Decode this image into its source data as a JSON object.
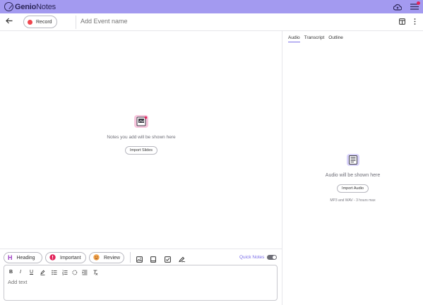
{
  "app": {
    "logo_bold": "Genio",
    "logo_light": "Notes"
  },
  "toolbar": {
    "record_label": "Record",
    "event_placeholder": "Add Event name"
  },
  "notes": {
    "empty_message": "Notes you add will be shown here",
    "import_slides_label": "Import Slides"
  },
  "right_panel": {
    "tabs": [
      {
        "label": "Audio",
        "active": true
      },
      {
        "label": "Transcript",
        "active": false
      },
      {
        "label": "Outline",
        "active": false
      }
    ],
    "empty_message": "Audio will be shown here",
    "import_audio_label": "Import Audio",
    "format_hint": "MP3 and WAV - 3 hours max"
  },
  "quickbar": {
    "chips": [
      {
        "label": "Heading",
        "icon": "heading-icon"
      },
      {
        "label": "Important",
        "icon": "important-icon"
      },
      {
        "label": "Review",
        "icon": "review-icon"
      }
    ],
    "tools": [
      "image-icon",
      "book-icon",
      "checkbox-icon",
      "pen-icon"
    ],
    "quick_notes_label": "Quick Notes",
    "quick_notes_on": false
  },
  "editor": {
    "placeholder": "Add text",
    "format_buttons": [
      "B",
      "I",
      "U"
    ]
  },
  "colors": {
    "appbar": "#a39af0",
    "accent": "#7b6ee8",
    "record": "#f0444c",
    "important": "#e2245b",
    "heading": "#9b3cc2",
    "review": "#f0a24a"
  }
}
